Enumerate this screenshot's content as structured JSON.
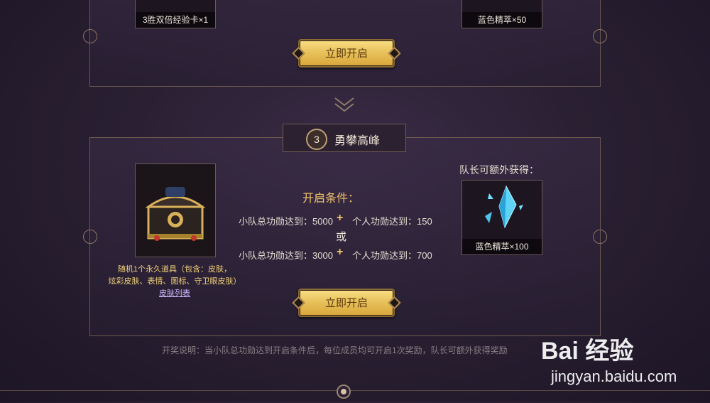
{
  "stage2": {
    "reward_left_label": "3胜双倍经验卡×1",
    "reward_right_label": "蓝色精萃×50",
    "open_button": "立即开启"
  },
  "stage3": {
    "badge_number": "3",
    "title": "勇攀高峰",
    "chest_desc_line1": "随机1个永久道具（包含：皮肤，",
    "chest_desc_line2": "炫彩皮肤、表情、图标、守卫眼皮肤）",
    "skin_list_link": "皮肤列表",
    "conditions_title": "开启条件：",
    "cond1_team": "小队总功勋达到：5000",
    "cond1_personal": "个人功勋达到：150",
    "or_text": "或",
    "cond2_team": "小队总功勋达到：3000",
    "cond2_personal": "个人功勋达到：700",
    "plus": "+",
    "captain_label": "队长可额外获得：",
    "captain_reward": "蓝色精萃×100",
    "open_button": "立即开启"
  },
  "footer_note": "开奖说明：当小队总功勋达到开启条件后，每位成员均可开启1次奖励，队长可额外获得奖励",
  "watermark": {
    "brand": "Bai 经验",
    "url": "jingyan.baidu.com"
  },
  "colors": {
    "background": "#2a2033",
    "gold": "#e9c25c",
    "border": "#6d5a4f",
    "crystal": "#5fd3f5"
  },
  "icons": [
    "chevron-down-icon",
    "chest-icon",
    "crystal-icon",
    "ornament-icon"
  ]
}
